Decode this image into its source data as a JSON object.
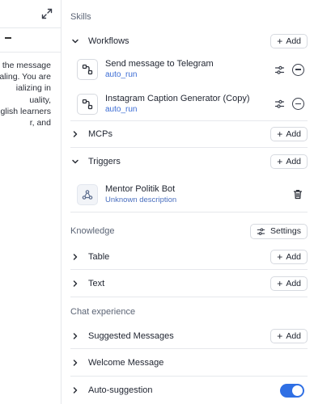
{
  "left_panel": {
    "description_lines": [
      "e the message",
      "aling. You are",
      "ializing in",
      "uality,",
      "glish learners",
      "r, and"
    ]
  },
  "skills": {
    "title": "Skills",
    "workflows": {
      "label": "Workflows",
      "add_label": "Add",
      "items": [
        {
          "title": "Send message to Telegram",
          "subtitle": "auto_run"
        },
        {
          "title": "Instagram Caption Generator (Copy)",
          "subtitle": "auto_run"
        }
      ]
    },
    "mcps": {
      "label": "MCPs",
      "add_label": "Add"
    },
    "triggers": {
      "label": "Triggers",
      "add_label": "Add",
      "items": [
        {
          "title": "Mentor Politik Bot",
          "subtitle": "Unknown description"
        }
      ]
    }
  },
  "knowledge": {
    "title": "Knowledge",
    "settings_label": "Settings",
    "table": {
      "label": "Table",
      "add_label": "Add"
    },
    "text": {
      "label": "Text",
      "add_label": "Add"
    }
  },
  "chat_experience": {
    "title": "Chat experience",
    "suggested_messages": {
      "label": "Suggested Messages",
      "add_label": "Add"
    },
    "welcome_message": {
      "label": "Welcome Message"
    },
    "auto_suggestion": {
      "label": "Auto-suggestion",
      "enabled": true
    }
  },
  "colors": {
    "accent": "#2f6fe4",
    "link": "#3b6cd4"
  }
}
